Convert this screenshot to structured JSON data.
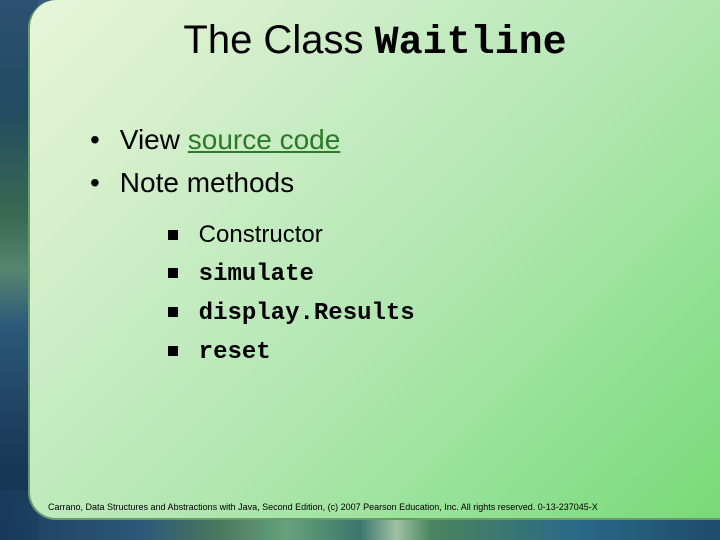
{
  "title": {
    "prefix": "The Class ",
    "classname": "Waitline"
  },
  "bullets": {
    "b1_prefix": "View ",
    "b1_link": "source code",
    "b2": "Note methods"
  },
  "subbullets": {
    "s1": "Constructor",
    "s2": "simulate",
    "s3": "display.Results",
    "s4": "reset"
  },
  "footer": "Carrano, Data Structures and Abstractions with Java, Second Edition, (c) 2007 Pearson Education, Inc. All rights reserved. 0-13-237045-X"
}
